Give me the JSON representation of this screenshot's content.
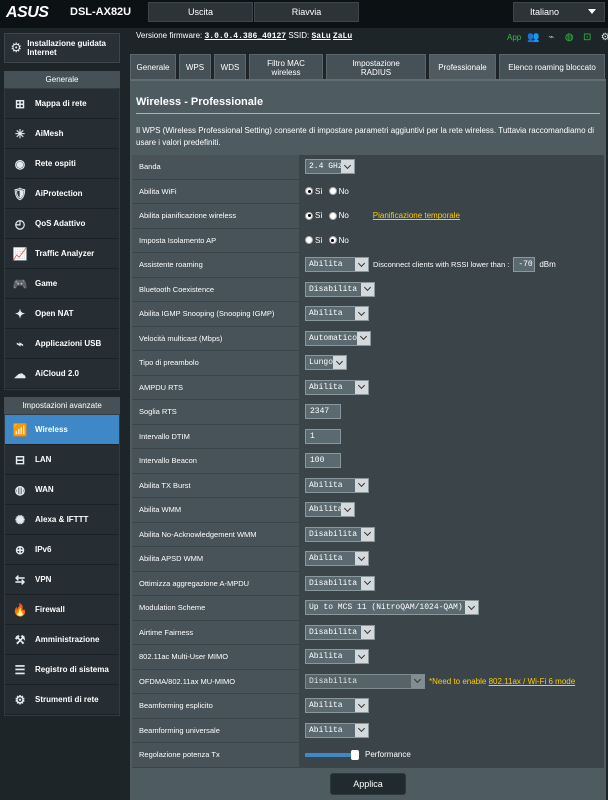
{
  "header": {
    "logo": "ASUS",
    "model": "DSL-AX82U",
    "logout": "Uscita",
    "reboot": "Riavvia",
    "language": "Italiano"
  },
  "sidebar": {
    "qis": "Installazione guidata Internet",
    "general_header": "Generale",
    "general": [
      {
        "label": "Mappa di rete",
        "icon": "network-map-icon"
      },
      {
        "label": "AiMesh",
        "icon": "aimesh-icon"
      },
      {
        "label": "Rete ospiti",
        "icon": "guest-network-icon"
      },
      {
        "label": "AiProtection",
        "icon": "shield-icon"
      },
      {
        "label": "QoS Adattivo",
        "icon": "qos-icon"
      },
      {
        "label": "Traffic Analyzer",
        "icon": "traffic-analyzer-icon"
      },
      {
        "label": "Game",
        "icon": "gamepad-icon"
      },
      {
        "label": "Open NAT",
        "icon": "open-nat-icon"
      },
      {
        "label": "Applicazioni USB",
        "icon": "usb-icon"
      },
      {
        "label": "AiCloud 2.0",
        "icon": "cloud-icon"
      }
    ],
    "advanced_header": "Impostazioni avanzate",
    "advanced": [
      {
        "label": "Wireless",
        "icon": "wifi-icon",
        "active": true
      },
      {
        "label": "LAN",
        "icon": "lan-icon"
      },
      {
        "label": "WAN",
        "icon": "globe-icon"
      },
      {
        "label": "Alexa & IFTTT",
        "icon": "alexa-icon"
      },
      {
        "label": "IPv6",
        "icon": "ipv6-icon"
      },
      {
        "label": "VPN",
        "icon": "vpn-icon"
      },
      {
        "label": "Firewall",
        "icon": "firewall-icon"
      },
      {
        "label": "Amministrazione",
        "icon": "admin-icon"
      },
      {
        "label": "Registro di sistema",
        "icon": "system-log-icon"
      },
      {
        "label": "Strumenti di rete",
        "icon": "network-tools-icon"
      }
    ]
  },
  "info": {
    "fw_label": "Versione firmware:",
    "fw_value": "3.0.0.4.386_40127",
    "ssid_label": "SSID:",
    "ssid1": "SaLu",
    "ssid2": "ZaLu",
    "app": "App"
  },
  "tabs": [
    "Generale",
    "WPS",
    "WDS",
    "Filtro MAC wireless",
    "Impostazione RADIUS",
    "Professionale",
    "Elenco roaming bloccato"
  ],
  "panel": {
    "title": "Wireless - Professionale",
    "description": "Il WPS (Wireless Professional Setting) consente di impostare parametri aggiuntivi per la rete wireless. Tuttavia raccomandiamo di usare i valori predefiniti.",
    "apply": "Applica"
  },
  "form": {
    "band": {
      "label": "Banda",
      "value": "2.4 GHz"
    },
    "wifi": {
      "label": "Abilita WiFi",
      "yes": "Sì",
      "no": "No"
    },
    "schedule": {
      "label": "Abilita pianificazione wireless",
      "yes": "Sì",
      "no": "No",
      "link": "Pianificazione temporale"
    },
    "isolation": {
      "label": "Imposta Isolamento AP",
      "yes": "Sì",
      "no": "No"
    },
    "roaming": {
      "label": "Assistente roaming",
      "value": "Abilita",
      "text": "Disconnect clients with RSSI lower than :",
      "rssi": "-70",
      "unit": "dBm"
    },
    "bt": {
      "label": "Bluetooth Coexistence",
      "value": "Disabilita"
    },
    "igmp": {
      "label": "Abilita IGMP Snooping (Snooping IGMP)",
      "value": "Abilita"
    },
    "mcast": {
      "label": "Velocità multicast (Mbps)",
      "value": "Automatico"
    },
    "preamble": {
      "label": "Tipo di preambolo",
      "value": "Lungo"
    },
    "ampdu_rts": {
      "label": "AMPDU RTS",
      "value": "Abilita"
    },
    "rts": {
      "label": "Soglia RTS",
      "value": "2347"
    },
    "dtim": {
      "label": "Intervallo DTIM",
      "value": "1"
    },
    "beacon": {
      "label": "Intervallo Beacon",
      "value": "100"
    },
    "txburst": {
      "label": "Abilita TX Burst",
      "value": "Abilita"
    },
    "wmm": {
      "label": "Abilita WMM",
      "value": "Abilita"
    },
    "noack": {
      "label": "Abilita No-Acknowledgement WMM",
      "value": "Disabilita"
    },
    "apsd": {
      "label": "Abilita APSD WMM",
      "value": "Abilita"
    },
    "ampdu_agg": {
      "label": "Ottimizza aggregazione A-MPDU",
      "value": "Disabilita"
    },
    "modulation": {
      "label": "Modulation Scheme",
      "value": "Up to MCS 11 (NitroQAM/1024-QAM)"
    },
    "airtime": {
      "label": "Airtime Fairness",
      "value": "Disabilita"
    },
    "mumimo": {
      "label": "802.11ac Multi-User MIMO",
      "value": "Abilita"
    },
    "ofdma": {
      "label": "OFDMA/802.11ax MU-MIMO",
      "value": "Disabilita",
      "note": "*Need to enable ",
      "note_link": "802.11ax / Wi-Fi 6 mode"
    },
    "bf_explicit": {
      "label": "Beamforming esplicito",
      "value": "Abilita"
    },
    "bf_universal": {
      "label": "Beamforming universale",
      "value": "Abilita"
    },
    "txpower": {
      "label": "Regolazione potenza Tx",
      "value_text": "Performance",
      "level": 1.0
    }
  }
}
